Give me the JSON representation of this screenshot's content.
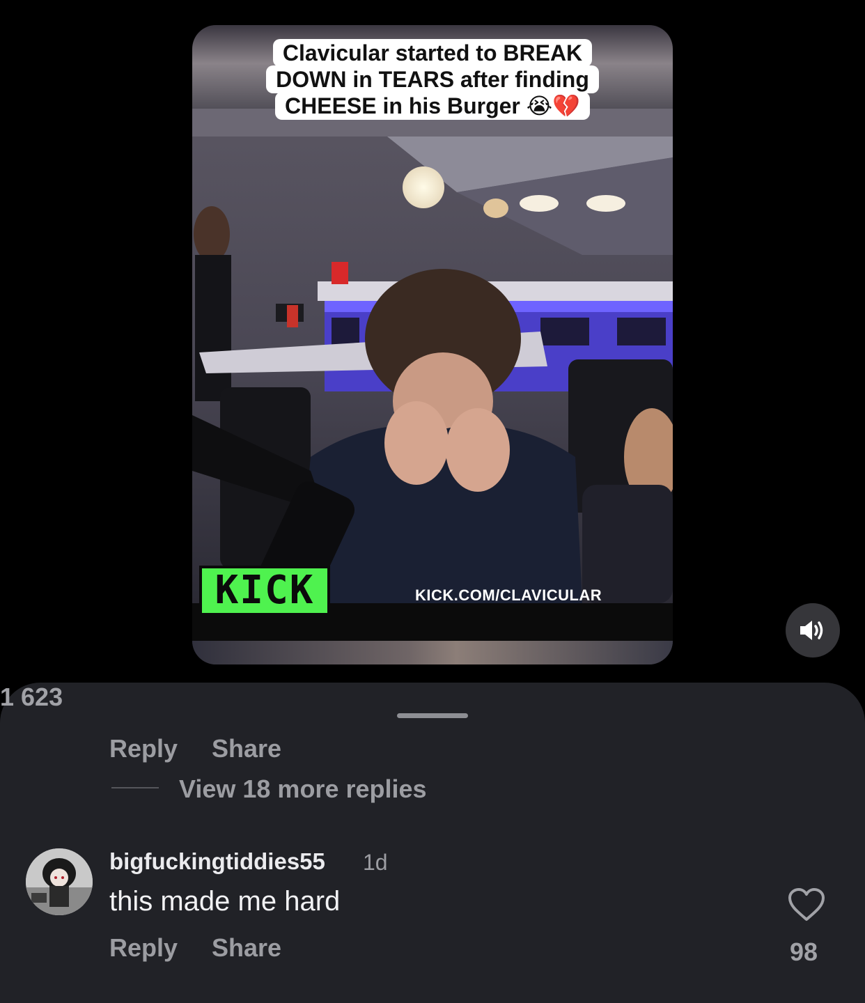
{
  "video": {
    "caption_lines": [
      "Clavicular started to BREAK",
      "DOWN in TEARS after finding",
      "CHEESE in his Burger 😭💔"
    ],
    "watermark_logo": "KICK",
    "watermark_url": "KICK.COM/CLAVICULAR"
  },
  "controls": {
    "sound_icon": "speaker-on-icon"
  },
  "thread": {
    "reply_label": "Reply",
    "share_label": "Share",
    "like_count": "1 623",
    "view_more_label": "View 18 more replies"
  },
  "comment": {
    "username": "bigfuckingtiddies55",
    "timestamp": "1d",
    "text": "this made me hard",
    "reply_label": "Reply",
    "share_label": "Share",
    "like_count": "98",
    "like_icon": "heart-outline-icon"
  }
}
